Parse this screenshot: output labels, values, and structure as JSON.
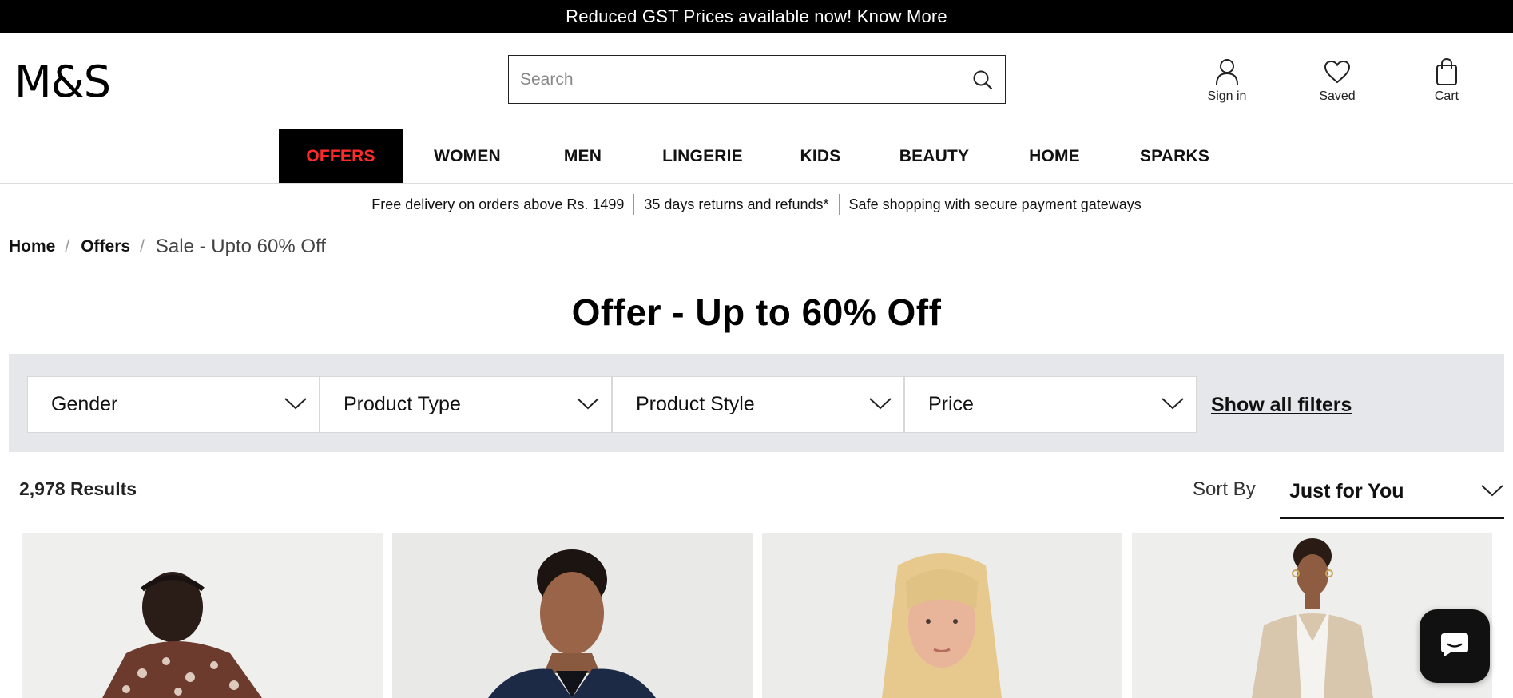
{
  "promo": {
    "text": "Reduced GST Prices available now! Know More"
  },
  "brand": {
    "logo": "M&S"
  },
  "search": {
    "placeholder": "Search",
    "value": "",
    "icon": "search-icon"
  },
  "account": [
    {
      "label": "Sign in",
      "icon": "user-icon"
    },
    {
      "label": "Saved",
      "icon": "heart-icon"
    },
    {
      "label": "Cart",
      "icon": "bag-icon"
    }
  ],
  "nav": {
    "items": [
      {
        "label": "OFFERS",
        "active": true
      },
      {
        "label": "WOMEN"
      },
      {
        "label": "MEN"
      },
      {
        "label": "LINGERIE"
      },
      {
        "label": "KIDS"
      },
      {
        "label": "BEAUTY"
      },
      {
        "label": "HOME"
      },
      {
        "label": "SPARKS"
      }
    ],
    "active_color": "#ff2a2a"
  },
  "usp": [
    "Free delivery on orders above Rs. 1499",
    "35 days returns and refunds*",
    "Safe shopping with secure payment gateways"
  ],
  "breadcrumb": {
    "items": [
      "Home",
      "Offers"
    ],
    "current": "Sale - Upto 60% Off",
    "separator": "/"
  },
  "page": {
    "title": "Offer - Up to 60% Off"
  },
  "filters": {
    "dropdowns": [
      {
        "label": "Gender"
      },
      {
        "label": "Product Type"
      },
      {
        "label": "Product Style"
      },
      {
        "label": "Price"
      }
    ],
    "show_all": "Show all filters"
  },
  "results": {
    "count": "2,978 Results",
    "sort_label": "Sort By",
    "sort_value": "Just for You"
  },
  "products": [
    {
      "description": "patterned shirt"
    },
    {
      "description": "navy suit"
    },
    {
      "description": "blonde model"
    },
    {
      "description": "beige blazer"
    }
  ],
  "chat": {
    "icon": "chat-icon"
  }
}
